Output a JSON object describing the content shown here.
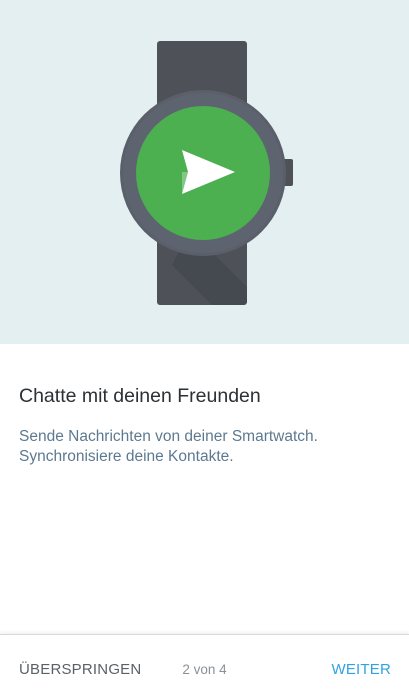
{
  "illustration": {
    "name": "smartwatch-send-icon",
    "background_color": "#e3eff0",
    "strap_color": "#4e5158",
    "bezel_color": "#5b5f6a",
    "face_color": "#4caf50",
    "icon_color": "#ffffff"
  },
  "content": {
    "title": "Chatte mit deinen Freunden",
    "description_line1": "Sende Nachrichten von deiner Smartwatch.",
    "description_line2": "Synchronisiere deine Kontakte."
  },
  "footer": {
    "skip_label": "ÜBERSPRINGEN",
    "pager_text": "2 von 4",
    "next_label": "WEITER",
    "accent_color": "#2ea3e3"
  }
}
